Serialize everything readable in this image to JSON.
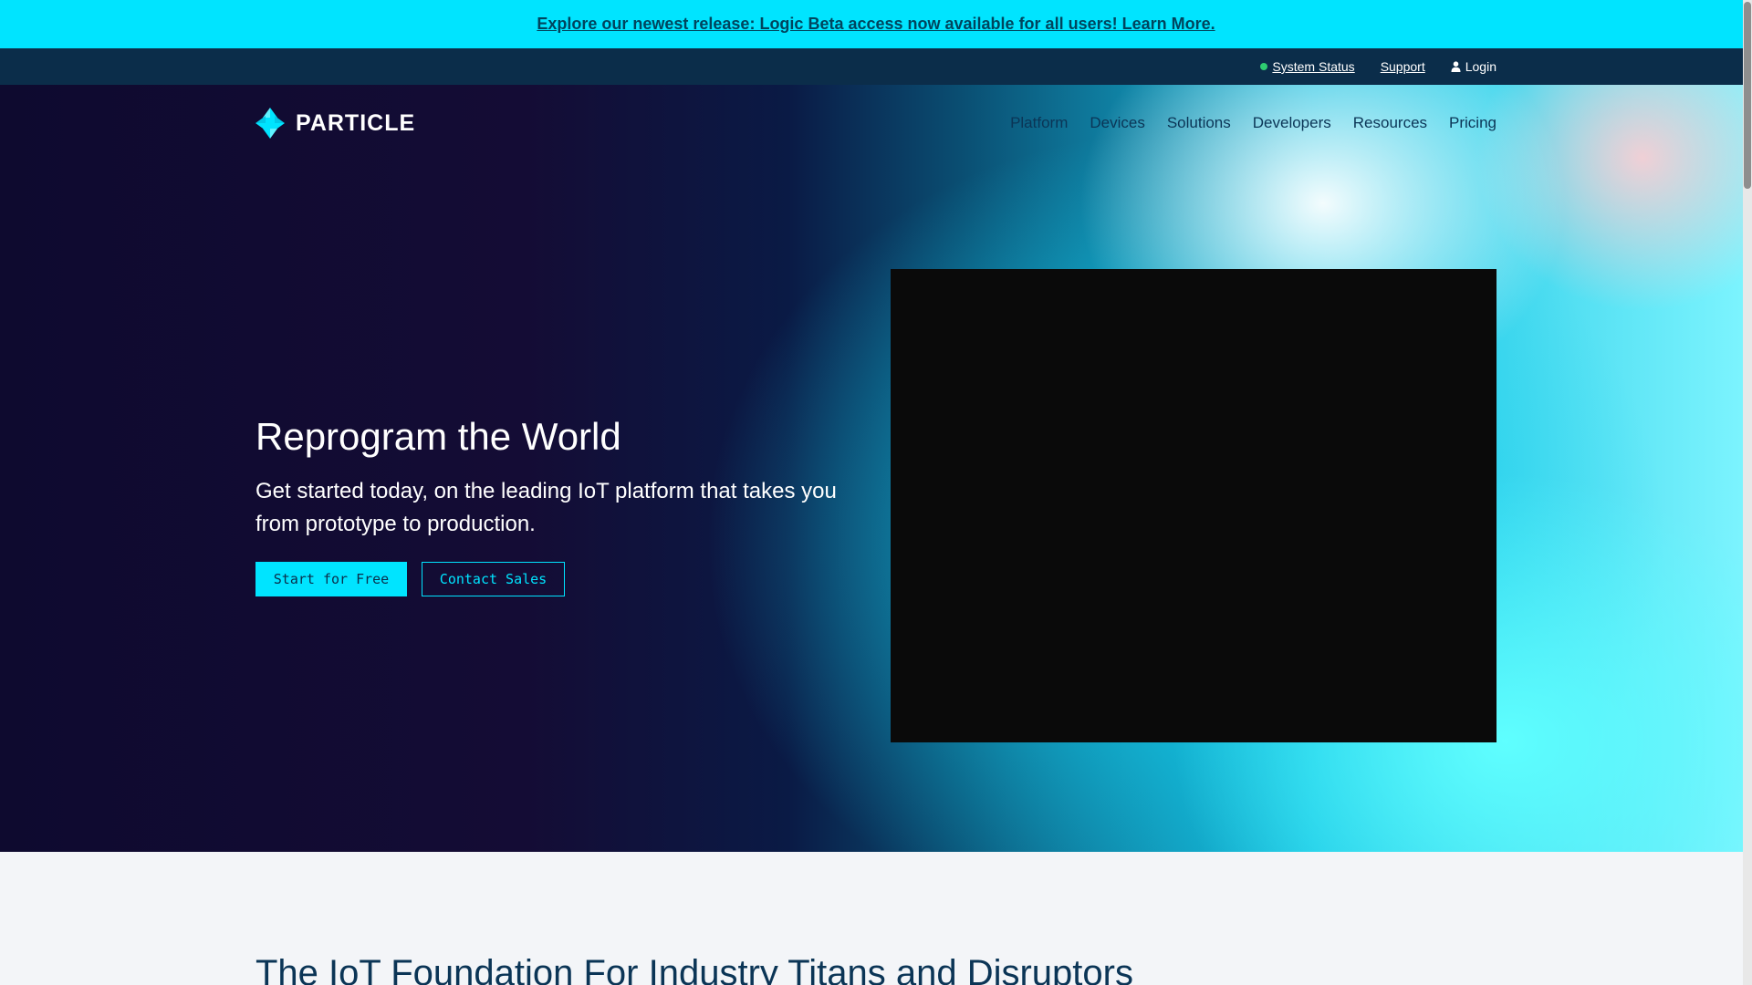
{
  "announcement": {
    "text": "Explore our newest release: Logic Beta access now available for all users! Learn More."
  },
  "utility_bar": {
    "system_status": "System Status",
    "support": "Support",
    "login": "Login",
    "status_color": "#2ecc71"
  },
  "brand": {
    "name": "PARTICLE",
    "logo_icon": "particle-logo-icon"
  },
  "nav": {
    "items": [
      "Platform",
      "Devices",
      "Solutions",
      "Developers",
      "Resources",
      "Pricing"
    ]
  },
  "hero": {
    "title": "Reprogram the World",
    "subtitle": "Get started today, on the leading IoT platform that takes you from prototype to production.",
    "primary_cta": "Start for Free",
    "secondary_cta": "Contact Sales"
  },
  "section": {
    "title": "The IoT Foundation For Industry Titans and Disruptors"
  },
  "colors": {
    "accent": "#00e4ff",
    "navy": "#0b2d4a",
    "nav_text": "#0b3556"
  }
}
